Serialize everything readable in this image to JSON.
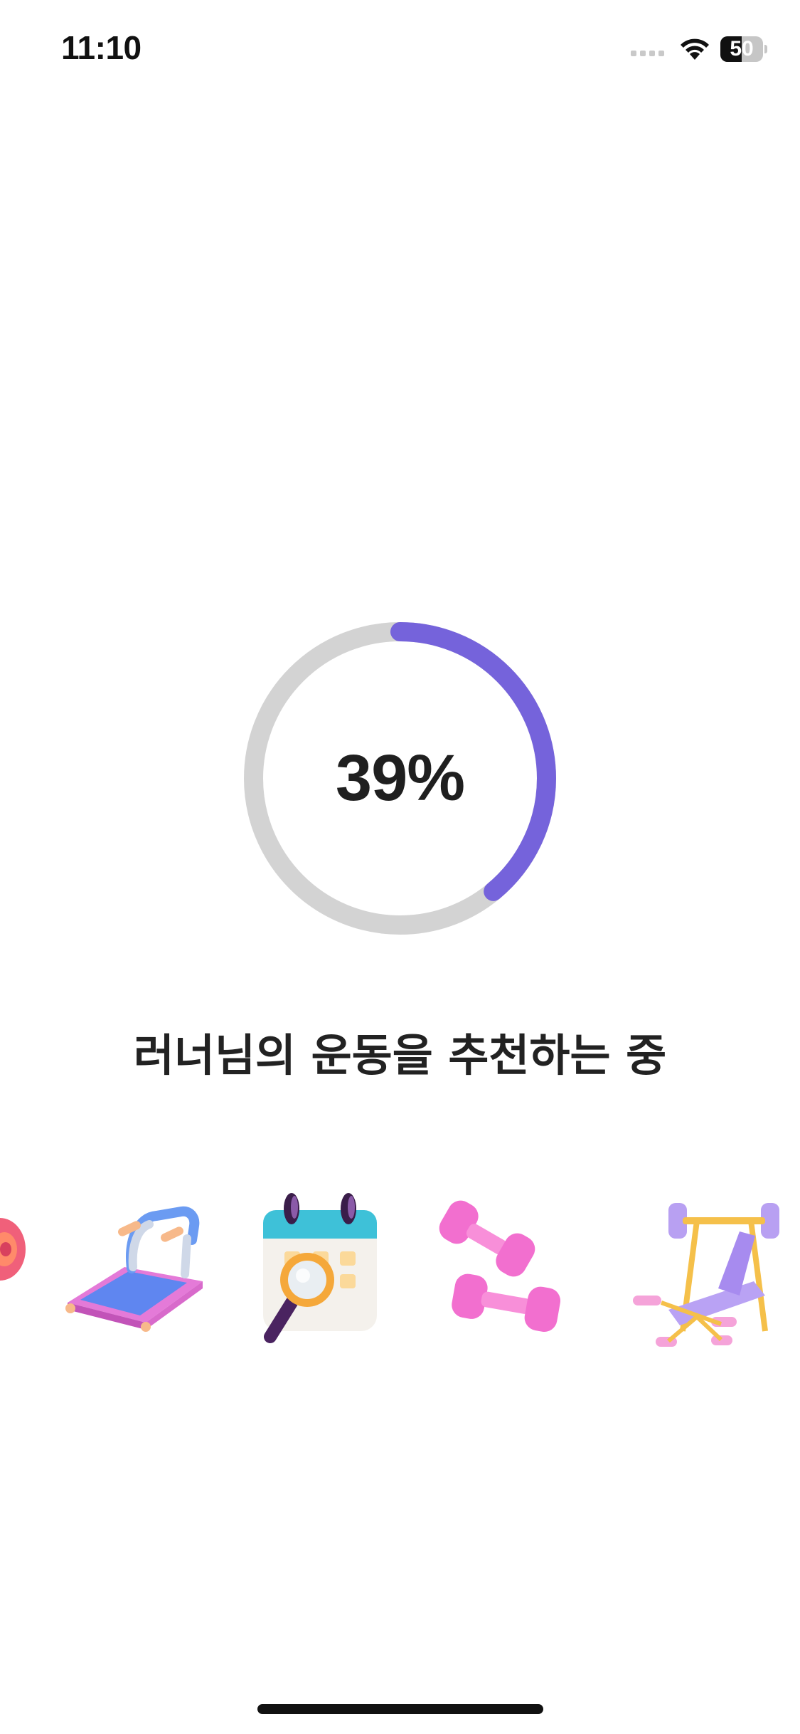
{
  "status_bar": {
    "time": "11:10",
    "battery_level": "50",
    "battery_fraction": 0.5,
    "icons": [
      "cellular-signal-icon",
      "wifi-icon",
      "battery-icon"
    ]
  },
  "progress": {
    "percent": 39,
    "label": "39%",
    "track_color": "#d3d3d3",
    "fill_color": "#7563db"
  },
  "message": "러너님의 운동을 추천하는 중",
  "equipment": [
    {
      "icon": "partial-equipment-icon"
    },
    {
      "icon": "treadmill-icon"
    },
    {
      "icon": "calendar-search-icon"
    },
    {
      "icon": "dumbbells-icon"
    },
    {
      "icon": "bench-press-icon"
    }
  ]
}
